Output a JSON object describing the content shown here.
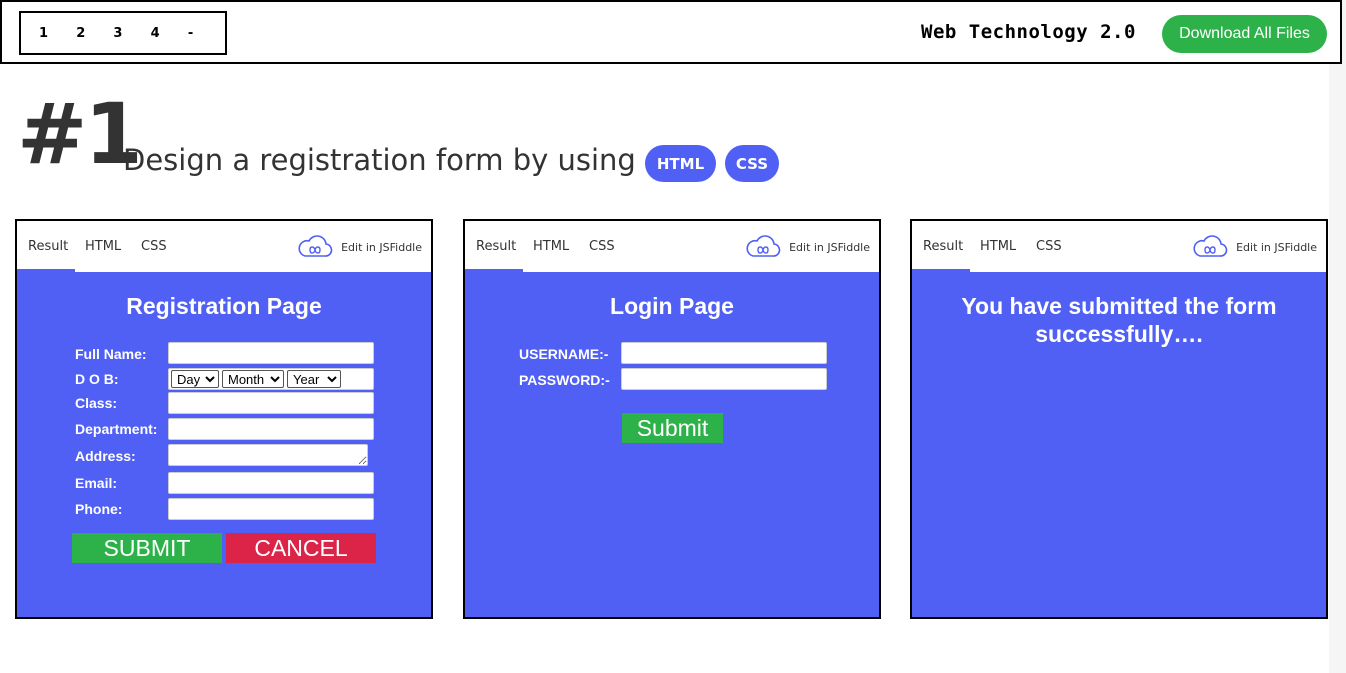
{
  "header": {
    "pages": [
      "1",
      "2",
      "3",
      "4",
      "-"
    ],
    "site_title": "Web Technology 2.0",
    "download_label": "Download All Files"
  },
  "headline": {
    "number": "#1",
    "text": "Design a registration form by using",
    "tags": [
      "HTML",
      "CSS"
    ]
  },
  "panel_tabs": {
    "result": "Result",
    "html": "HTML",
    "css": "CSS",
    "edit_link": "Edit in JSFiddle"
  },
  "registration": {
    "title": "Registration Page",
    "labels": {
      "full_name": "Full Name:",
      "dob": "D O B:",
      "class": "Class:",
      "department": "Department:",
      "address": "Address:",
      "email": "Email:",
      "phone": "Phone:"
    },
    "dob_selects": {
      "day": "Day",
      "month": "Month",
      "year": "Year"
    },
    "submit_label": "SUBMIT",
    "cancel_label": "CANCEL"
  },
  "login": {
    "title": "Login Page",
    "username_label": "USERNAME:-",
    "password_label": "PASSWORD:-",
    "submit_label": "Submit"
  },
  "success": {
    "message_line1": "You have submitted the form",
    "message_line2": "successfully…."
  },
  "colors": {
    "panel_bg": "#5060f5",
    "download_green": "#2db24a",
    "submit_green": "#2db24a",
    "cancel_red": "#dc2448"
  },
  "icons": {
    "jsfiddle": "cloud-infinity-icon"
  }
}
